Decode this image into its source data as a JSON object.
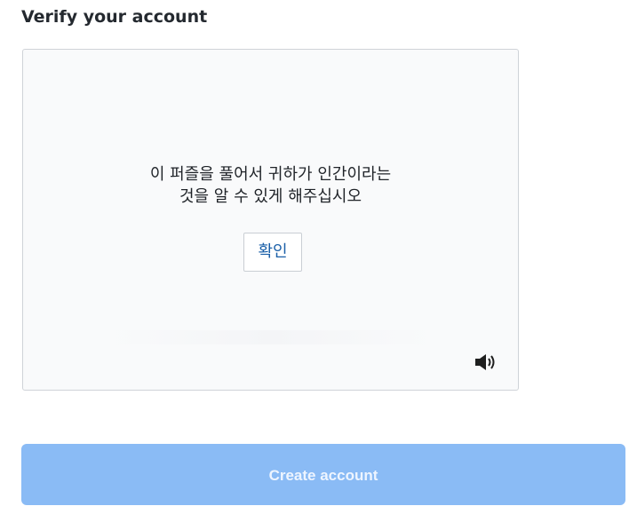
{
  "header": {
    "title": "Verify your account"
  },
  "captcha": {
    "message_line1": "이 퍼즐을 풀어서 귀하가 인간이라는",
    "message_line2": "것을 알 수 있게 해주십시오",
    "verify_label": "확인",
    "audio_icon": "speaker-icon"
  },
  "form": {
    "submit_label": "Create account"
  }
}
